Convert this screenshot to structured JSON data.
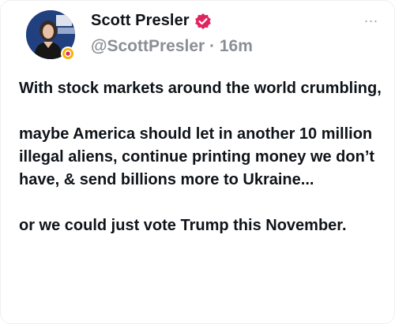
{
  "author": {
    "display_name": "Scott Presler",
    "handle": "@ScottPresler",
    "separator": "·",
    "time": "16m",
    "verified_color": "#e0245e",
    "icons": [
      "verified-badge-icon",
      "avatar-image",
      "affiliate-badge-icon",
      "more-options-icon"
    ]
  },
  "tweet": {
    "paragraphs": [
      "With stock markets around the world crumbling,",
      "maybe America should let in another 10 million illegal aliens, continue printing money we don’t have, & send billions more to Ukraine...",
      "or we could just vote Trump this November."
    ]
  },
  "more_options": "..."
}
